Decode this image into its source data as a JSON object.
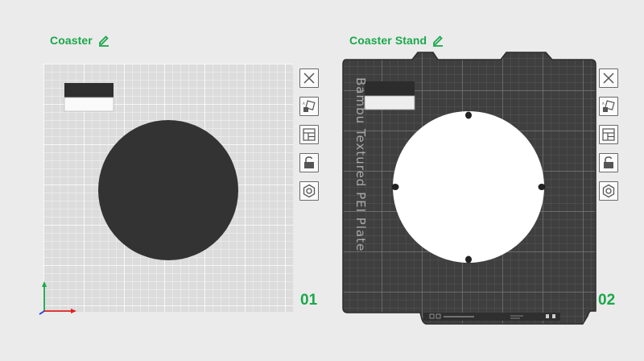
{
  "plates": [
    {
      "name": "Coaster",
      "number": "01",
      "bed_color": "#dcdcdc",
      "object_color": "#333333"
    },
    {
      "name": "Coaster Stand",
      "number": "02",
      "bed_color": "#3f3f3f",
      "plate_label": "Bambu Textured PEI Plate",
      "object_color": "#ffffff"
    }
  ],
  "toolbar_icons": [
    "close-icon",
    "auto-orient-icon",
    "arrange-icon",
    "lock-icon",
    "settings-icon"
  ],
  "colors": {
    "accent": "#1aa84a",
    "axis_x": "#e02020",
    "axis_y": "#1aa84a",
    "axis_z": "#2040e0"
  }
}
